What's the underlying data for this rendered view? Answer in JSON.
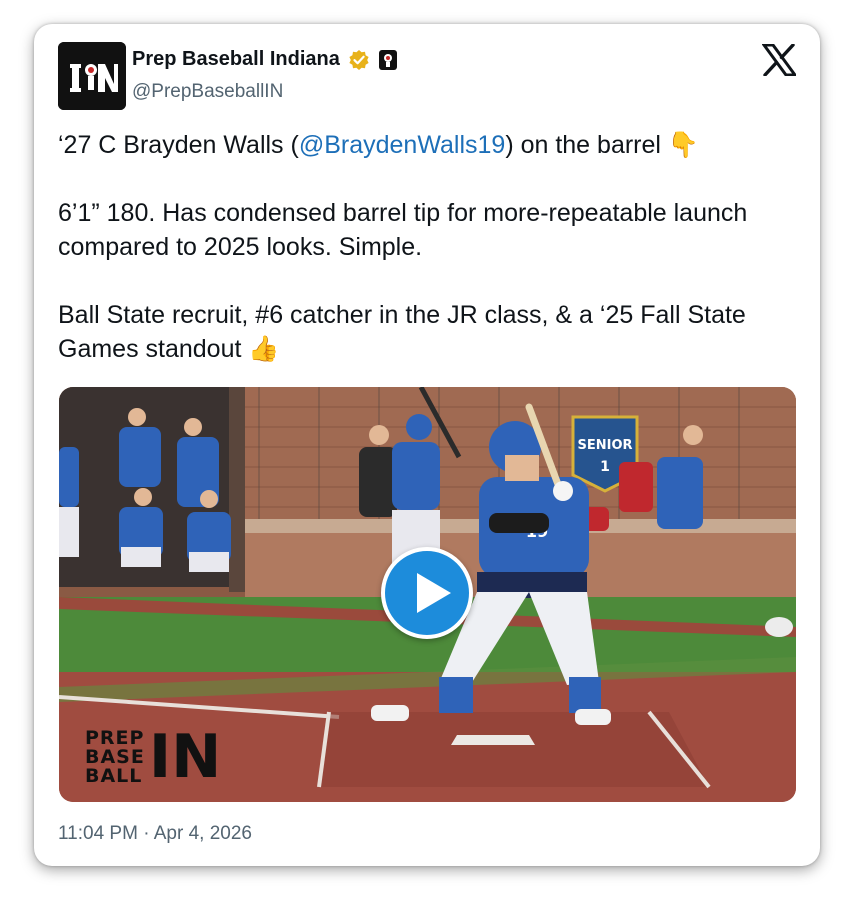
{
  "author": {
    "display_name": "Prep Baseball Indiana",
    "handle": "@PrepBaseballIN",
    "avatar_text": "IN",
    "verified_icon": "gold-verified-badge",
    "affiliate_icon": "affiliate-badge"
  },
  "tweet": {
    "line1_pre": "‘27 C Brayden Walls (",
    "line1_mention": "@BraydenWalls19",
    "line1_post": ") on the barrel 👇",
    "para2": "6’1” 180. Has condensed barrel tip for more-repeatable launch compared to 2025 looks. Simple.",
    "para3": "Ball State recruit, #6 catcher in the JR class, & a ‘25 Fall State Games standout 👍"
  },
  "media": {
    "type": "video",
    "jersey_number": "19",
    "banner_text": "SENIOR",
    "banner_number": "1",
    "watermark_lines": [
      "PREP",
      "BASE",
      "BALL"
    ],
    "watermark_in": "IN"
  },
  "timestamp": "11:04 PM · Apr 4, 2026",
  "colors": {
    "mention": "#1d6fb8",
    "play_button": "#1d8cdb",
    "verified": "#e8b21a"
  }
}
